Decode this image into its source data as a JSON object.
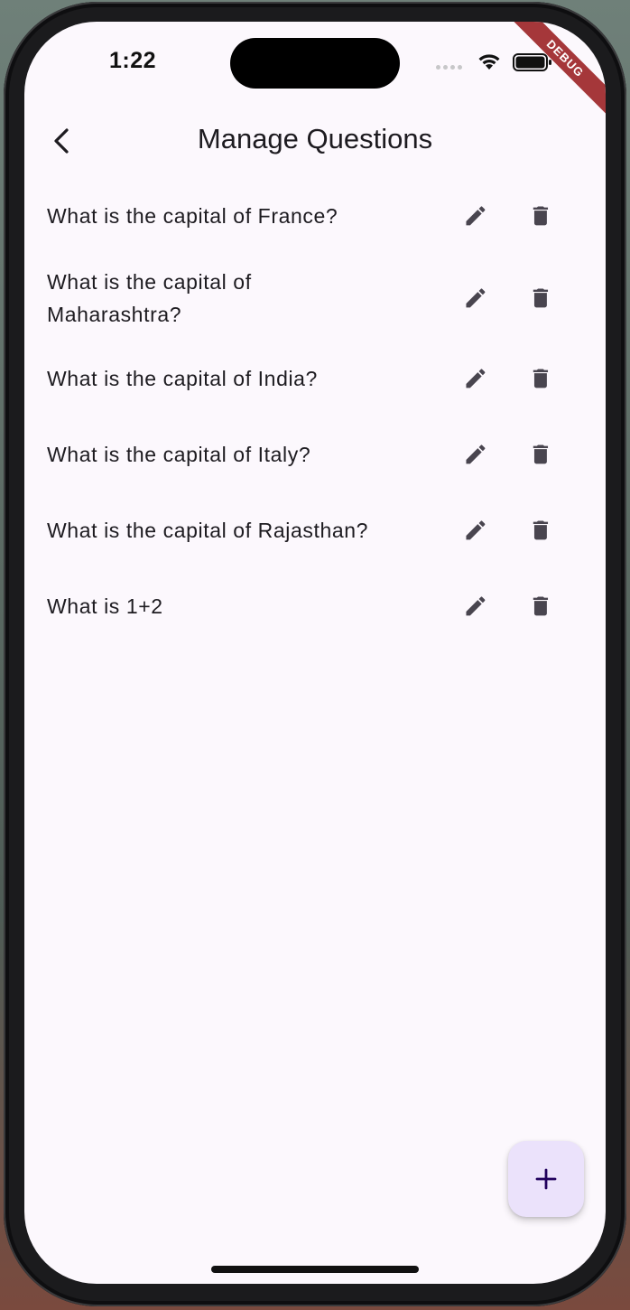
{
  "status_bar": {
    "time": "1:22",
    "debug_label": "DEBUG"
  },
  "app_bar": {
    "title": "Manage Questions",
    "back_icon": "chevron-left-icon"
  },
  "questions": [
    {
      "text": "What is the capital of France?"
    },
    {
      "text": "What is the capital of Maharashtra?"
    },
    {
      "text": "What is the capital of India?"
    },
    {
      "text": "What is the capital of Italy?"
    },
    {
      "text": "What is the capital of Rajasthan?"
    },
    {
      "text": "What is 1+2"
    }
  ],
  "row_actions": {
    "edit_icon": "pencil-icon",
    "delete_icon": "trash-icon"
  },
  "fab": {
    "icon": "plus-icon"
  },
  "colors": {
    "background": "#fcf8fd",
    "icon": "#49454f",
    "fab_background": "#ebe2fb",
    "fab_icon": "#21005d",
    "debug_ribbon": "#a5373a"
  }
}
